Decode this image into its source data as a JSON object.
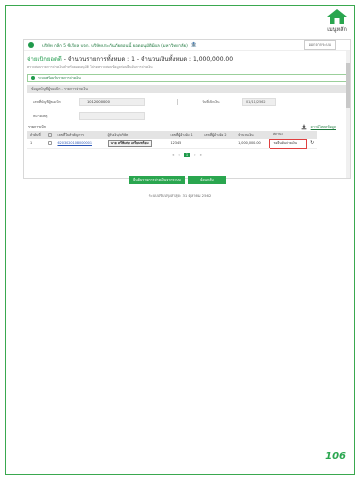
{
  "home": {
    "label": "เมนูหลัก",
    "icon": "home-icon"
  },
  "userbar": {
    "text": "บริษัท กลีก 5 ซีเรียล บจก. บริษัทประกันภัยตอนนี้ ยอดอนุมัติมีผล (มหาวิทยาลัย)",
    "glyph": "🏦",
    "logout_label": "ออกจากระบบ"
  },
  "header": {
    "title_prefix": "จ่ายเบิกยอดดี",
    "title_rest": " - จำนวนรายการทั้งหมด : 1 - จำนวนเงินทั้งหมด : 1,000,000.00",
    "subtitle": "ตรวจสอบรายการจ่ายเงินสำหรับยอดอนุมัติ โปรดตรวจสอบข้อมูลก่อนยืนยันการจ่ายเงิน"
  },
  "notice": {
    "text": "ระบบพร้อมรับรายการจ่ายเงิน"
  },
  "section": {
    "label": "ข้อมูลบัญชีผู้ขอเบิก - รายการจ่ายเงิน"
  },
  "form": {
    "account_label": "เลขที่บัญชีผู้ขอเบิก",
    "account_value": "1012000000",
    "date_label": "วันที่เบิกเงิน",
    "date_value": "01/11/2562",
    "note_label": "หมายเหตุ",
    "note_value": ""
  },
  "list": {
    "title": "รายการเบิก",
    "download_label": "ดาวน์โหลดข้อมูล",
    "columns": [
      "ลำดับที่",
      "",
      "เลขที่ใบสำคัญการ",
      "ผู้รับเงิน/บริษัท",
      "เลขที่ผู้อ้างอิง 1",
      "เลขที่ผู้อ้างอิง 2",
      "จำนวนเงิน",
      "สถานะ",
      ""
    ],
    "rows": [
      {
        "seq": "1",
        "doc_no": "6203020108000001",
        "payee": "นาย ตรีพิเศษ เตรียมพร้อม",
        "ref1": "12345",
        "ref2": "",
        "amount": "1,000,000.00",
        "status": "รอยืนยันจ่ายเงิน"
      }
    ]
  },
  "pager": {
    "prev": "‹",
    "first": "«",
    "current": "1",
    "next": "›",
    "last": "»"
  },
  "buttons": {
    "confirm_label": "ยืนยันรายการจ่ายเงินจากระบบ",
    "back_label": "ย้อนกลับ"
  },
  "footnote": "ระบบปรับปรุงล่าสุด: 31 ตุลาคม 2562",
  "page_number": "106",
  "colors": {
    "accent": "#2aa64f",
    "frame": "#3aa84f",
    "status_border": "#e04040"
  }
}
